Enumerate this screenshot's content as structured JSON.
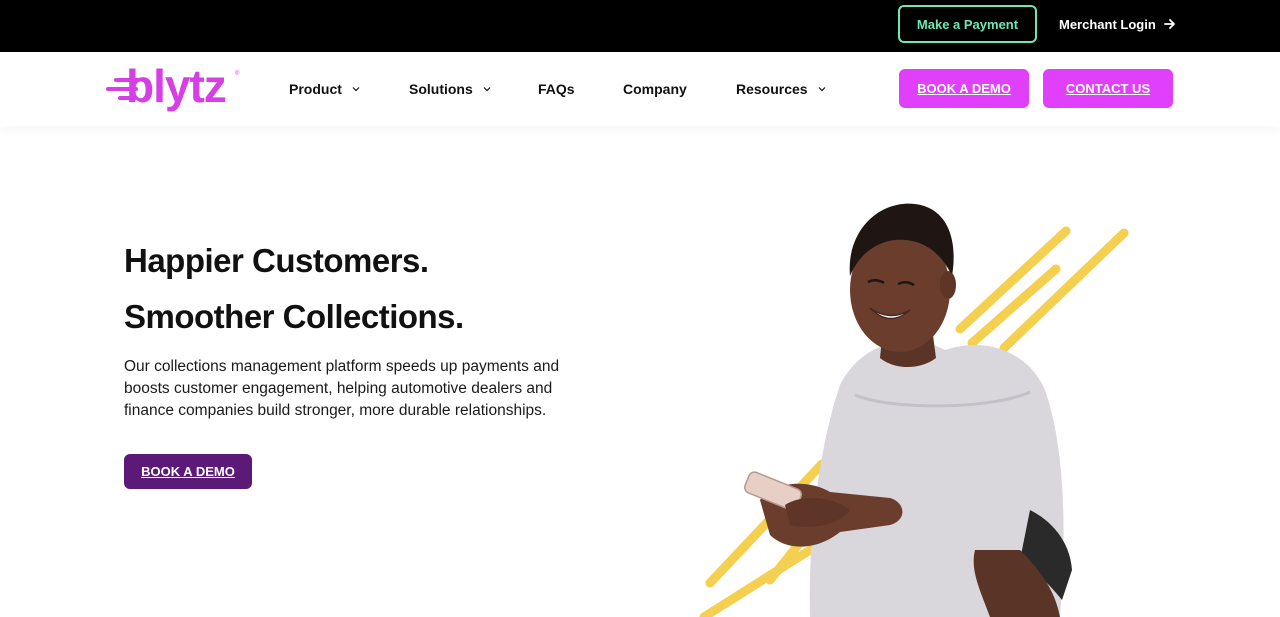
{
  "topbar": {
    "payment_label": "Make a Payment",
    "merchant_label": "Merchant Login",
    "merchant_icon": "arrow-right-icon"
  },
  "brand": {
    "name": "blytz",
    "trademark": "®",
    "color": "#d63fe6"
  },
  "nav": {
    "items": [
      {
        "label": "Product",
        "has_dropdown": true
      },
      {
        "label": "Solutions",
        "has_dropdown": true
      },
      {
        "label": "FAQs",
        "has_dropdown": false
      },
      {
        "label": "Company",
        "has_dropdown": false
      },
      {
        "label": "Resources",
        "has_dropdown": true
      }
    ],
    "book_demo_label": "BOOK A DEMO",
    "contact_label": "CONTACT US"
  },
  "hero": {
    "title_line1": "Happier Customers.",
    "title_line2": "Smoother Collections.",
    "body": "Our collections management platform speeds up payments and boosts customer engagement, helping automotive dealers and finance companies build stronger, more durable relationships.",
    "cta_label": "BOOK A DEMO",
    "image": "smiling-woman-with-phone",
    "accent_color": "#f5cf4f"
  },
  "colors": {
    "topbar_bg": "#000000",
    "payment_outline": "#6ee7b7",
    "magenta": "#e040fb",
    "hero_button": "#5b1a78"
  }
}
